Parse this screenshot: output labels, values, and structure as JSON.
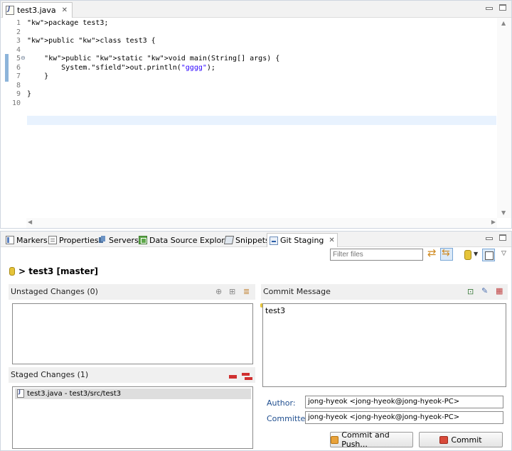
{
  "editor": {
    "tab_title": "test3.java",
    "close_glyph": "✕",
    "lines": [
      {
        "num": "1",
        "html_kind": "pkg",
        "text": "package test3;"
      },
      {
        "num": "2",
        "text": ""
      },
      {
        "num": "3",
        "html_kind": "cls",
        "text": "public class test3 {"
      },
      {
        "num": "4",
        "text": ""
      },
      {
        "num": "5",
        "html_kind": "main",
        "text": "    public static void main(String[] args) {"
      },
      {
        "num": "6",
        "html_kind": "println",
        "text": "        System.out.println(\"gggg\");"
      },
      {
        "num": "7",
        "text": "    }"
      },
      {
        "num": "8",
        "text": ""
      },
      {
        "num": "9",
        "text": "}"
      },
      {
        "num": "10",
        "text": ""
      }
    ]
  },
  "views": {
    "tabs": [
      {
        "label": "Markers",
        "icon": "markers-icon"
      },
      {
        "label": "Properties",
        "icon": "properties-icon"
      },
      {
        "label": "Servers",
        "icon": "servers-icon"
      },
      {
        "label": "Data Source Explorer",
        "icon": "data-source-explorer-icon"
      },
      {
        "label": "Snippets",
        "icon": "snippets-icon"
      },
      {
        "label": "Git Staging",
        "icon": "git-staging-icon",
        "active": true
      }
    ],
    "close_glyph": "✕"
  },
  "git_staging": {
    "filter_placeholder": "Filter files",
    "repo_label": "> test3 [master]",
    "unstaged_header": "Unstaged Changes (0)",
    "staged_header": "Staged Changes (1)",
    "staged_items": [
      {
        "label": "test3.java - test3/src/test3"
      }
    ],
    "commit_message_header": "Commit Message",
    "commit_message": "test3",
    "author_label": "Author:",
    "author_value": "jong-hyeok <jong-hyeok@jong-hyeok-PC>",
    "committer_label": "Committer:",
    "committer_value": "jong-hyeok <jong-hyeok@jong-hyeok-PC>",
    "commit_push_label": "Commit and Push...",
    "commit_label": "Commit"
  }
}
